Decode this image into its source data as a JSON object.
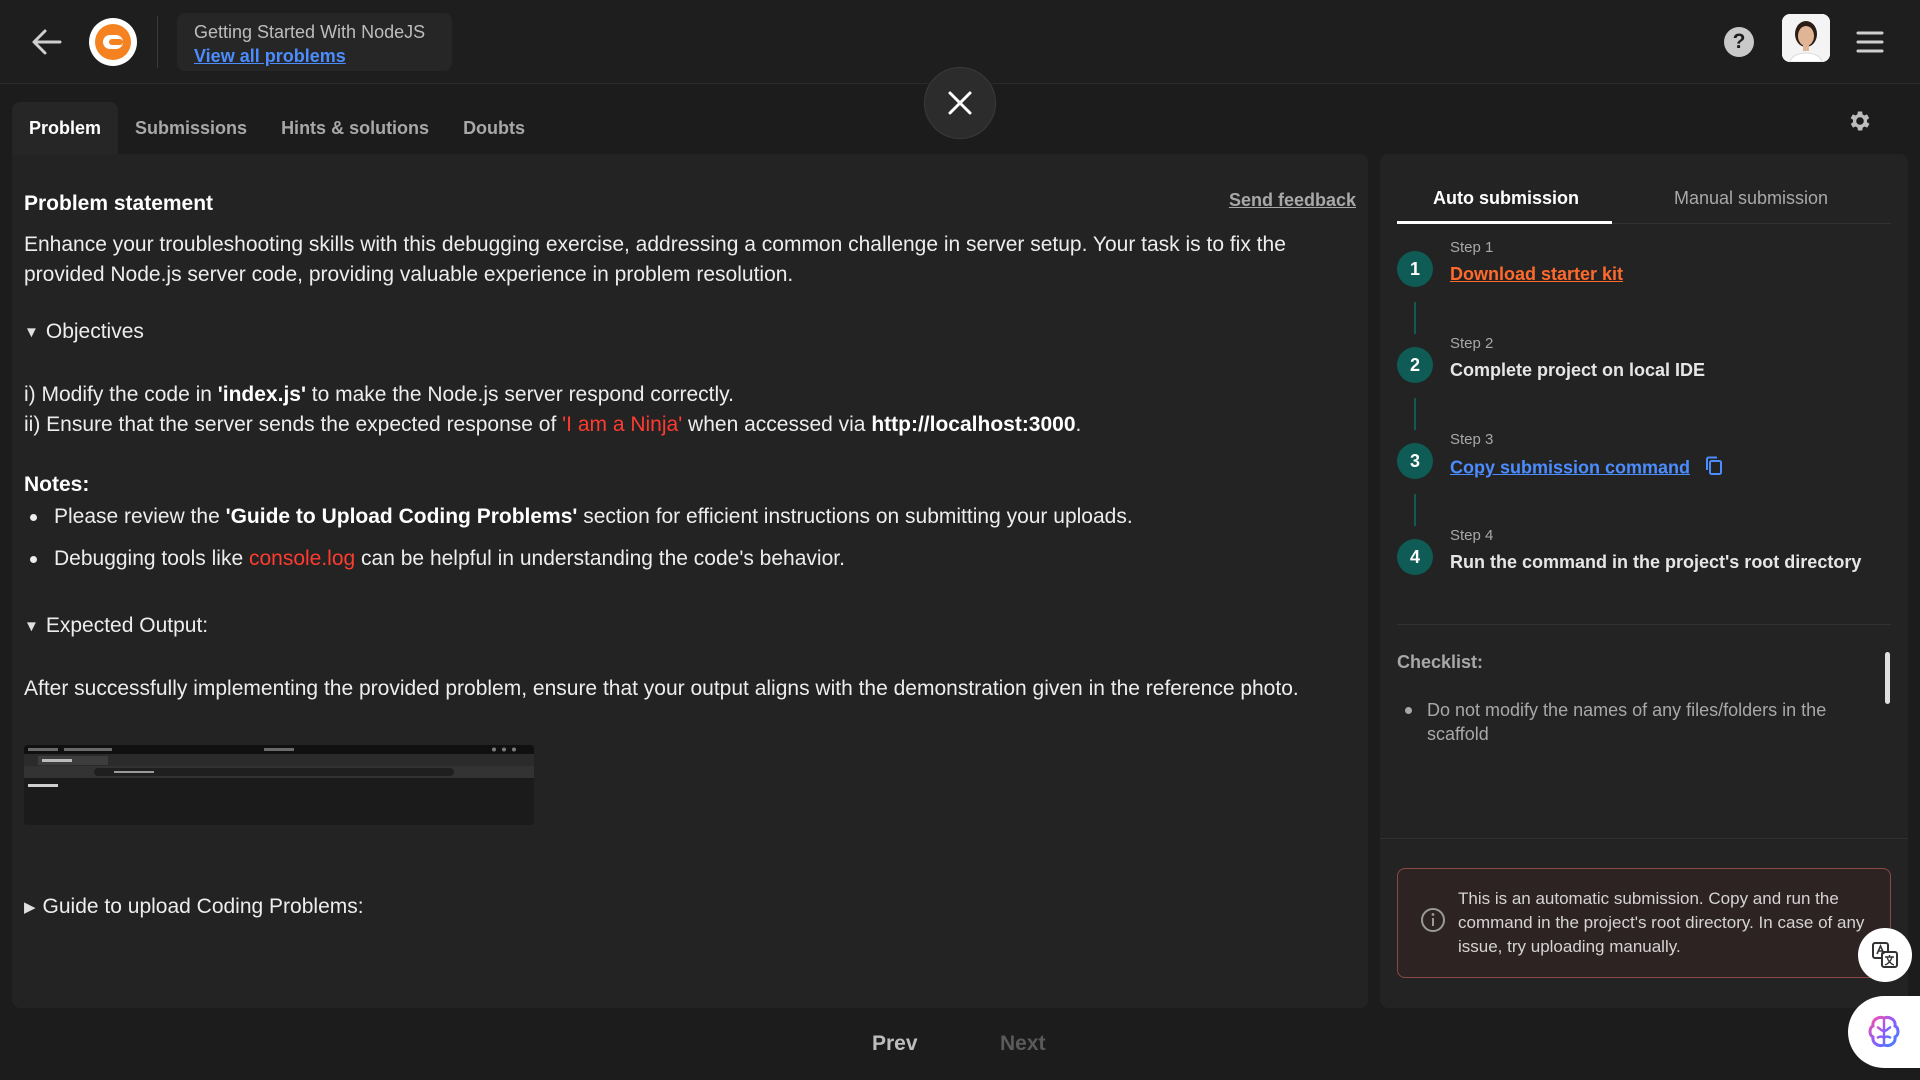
{
  "header": {
    "course_title": "Getting Started With NodeJS",
    "view_all_label": "View all problems",
    "help_label": "?"
  },
  "tabs": [
    {
      "label": "Problem",
      "active": true
    },
    {
      "label": "Submissions",
      "active": false
    },
    {
      "label": "Hints & solutions",
      "active": false
    },
    {
      "label": "Doubts",
      "active": false
    }
  ],
  "problem": {
    "title": "Problem statement",
    "feedback_label": "Send feedback",
    "intro": "Enhance your troubleshooting skills with this debugging exercise, addressing a common challenge in server setup. Your task is to fix the provided Node.js server code, providing valuable experience in problem resolution.",
    "objectives_label": "Objectives",
    "obj1_prefix": "i) Modify the code in ",
    "obj1_file": "'index.js'",
    "obj1_suffix": " to make the Node.js server respond correctly.",
    "obj2_prefix": "ii) Ensure that the server sends the expected response of ",
    "obj2_response": "'I am a Ninja'",
    "obj2_mid": " when accessed via ",
    "obj2_url": "http://localhost:3000",
    "obj2_end": ".",
    "notes_label": "Notes:",
    "note1_prefix": "Please review the ",
    "note1_bold": "'Guide to Upload Coding Problems'",
    "note1_suffix": " section for efficient instructions on submitting your uploads.",
    "note2_prefix": "Debugging tools like ",
    "note2_code": "console.log",
    "note2_suffix": " can be helpful in understanding the code's behavior.",
    "expected_label": "Expected Output:",
    "expected_text": "After successfully implementing the provided problem, ensure that your output aligns with the demonstration given in the reference photo.",
    "guide_label": "Guide to upload Coding Problems:"
  },
  "submission": {
    "tabs": [
      {
        "label": "Auto submission",
        "active": true
      },
      {
        "label": "Manual submission",
        "active": false
      }
    ],
    "steps": [
      {
        "number": "1",
        "label": "Step 1",
        "text": "Download starter kit"
      },
      {
        "number": "2",
        "label": "Step 2",
        "text": "Complete project on local IDE"
      },
      {
        "number": "3",
        "label": "Step 3",
        "text": "Copy submission command"
      },
      {
        "number": "4",
        "label": "Step 4",
        "text": "Run the command in the project's root directory"
      }
    ],
    "checklist_title": "Checklist:",
    "checklist_items": [
      "Do not modify the names of any files/folders in the scaffold"
    ],
    "info_text": "This is an automatic submission. Copy and run the command in the project's root directory. In case of any issue, try uploading manually."
  },
  "footer": {
    "prev_label": "Prev",
    "next_label": "Next"
  },
  "colors": {
    "accent_teal": "#0f5b55",
    "link_blue": "#4b8dff",
    "link_orange": "#ff6a2c",
    "highlight_red": "#ff3b30"
  }
}
